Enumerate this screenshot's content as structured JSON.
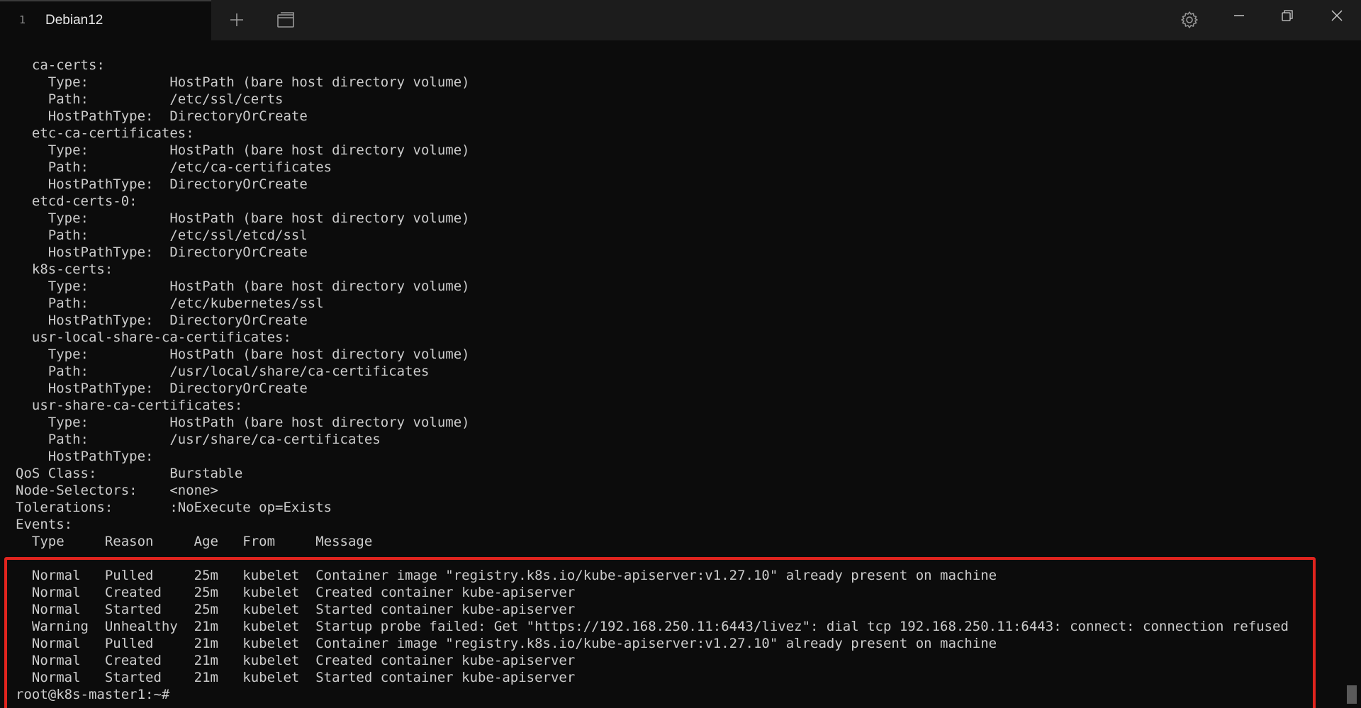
{
  "tab": {
    "index": "1",
    "title": "Debian12"
  },
  "icons": {
    "new_tab": "plus-icon",
    "dropdown": "window-layout-icon",
    "settings": "gear-icon",
    "minimize": "minimize-icon",
    "restore": "restore-icon",
    "close": "close-icon"
  },
  "colors": {
    "background": "#0c0c0c",
    "text": "#cccccc",
    "highlight": "#e0241e"
  },
  "terminal": {
    "lines": [
      "  ca-certs:",
      "    Type:          HostPath (bare host directory volume)",
      "    Path:          /etc/ssl/certs",
      "    HostPathType:  DirectoryOrCreate",
      "  etc-ca-certificates:",
      "    Type:          HostPath (bare host directory volume)",
      "    Path:          /etc/ca-certificates",
      "    HostPathType:  DirectoryOrCreate",
      "  etcd-certs-0:",
      "    Type:          HostPath (bare host directory volume)",
      "    Path:          /etc/ssl/etcd/ssl",
      "    HostPathType:  DirectoryOrCreate",
      "  k8s-certs:",
      "    Type:          HostPath (bare host directory volume)",
      "    Path:          /etc/kubernetes/ssl",
      "    HostPathType:  DirectoryOrCreate",
      "  usr-local-share-ca-certificates:",
      "    Type:          HostPath (bare host directory volume)",
      "    Path:          /usr/local/share/ca-certificates",
      "    HostPathType:  DirectoryOrCreate",
      "  usr-share-ca-certificates:",
      "    Type:          HostPath (bare host directory volume)",
      "    Path:          /usr/share/ca-certificates",
      "    HostPathType:",
      "QoS Class:         Burstable",
      "Node-Selectors:    <none>",
      "Tolerations:       :NoExecute op=Exists",
      "Events:",
      "  Type     Reason     Age   From     Message",
      "  ----     ------     ----  ----     -------",
      "  Normal   Pulled     25m   kubelet  Container image \"registry.k8s.io/kube-apiserver:v1.27.10\" already present on machine",
      "  Normal   Created    25m   kubelet  Created container kube-apiserver",
      "  Normal   Started    25m   kubelet  Started container kube-apiserver",
      "  Warning  Unhealthy  21m   kubelet  Startup probe failed: Get \"https://192.168.250.11:6443/livez\": dial tcp 192.168.250.11:6443: connect: connection refused",
      "  Normal   Pulled     21m   kubelet  Container image \"registry.k8s.io/kube-apiserver:v1.27.10\" already present on machine",
      "  Normal   Created    21m   kubelet  Created container kube-apiserver",
      "  Normal   Started    21m   kubelet  Started container kube-apiserver",
      "root@k8s-master1:~#"
    ]
  }
}
